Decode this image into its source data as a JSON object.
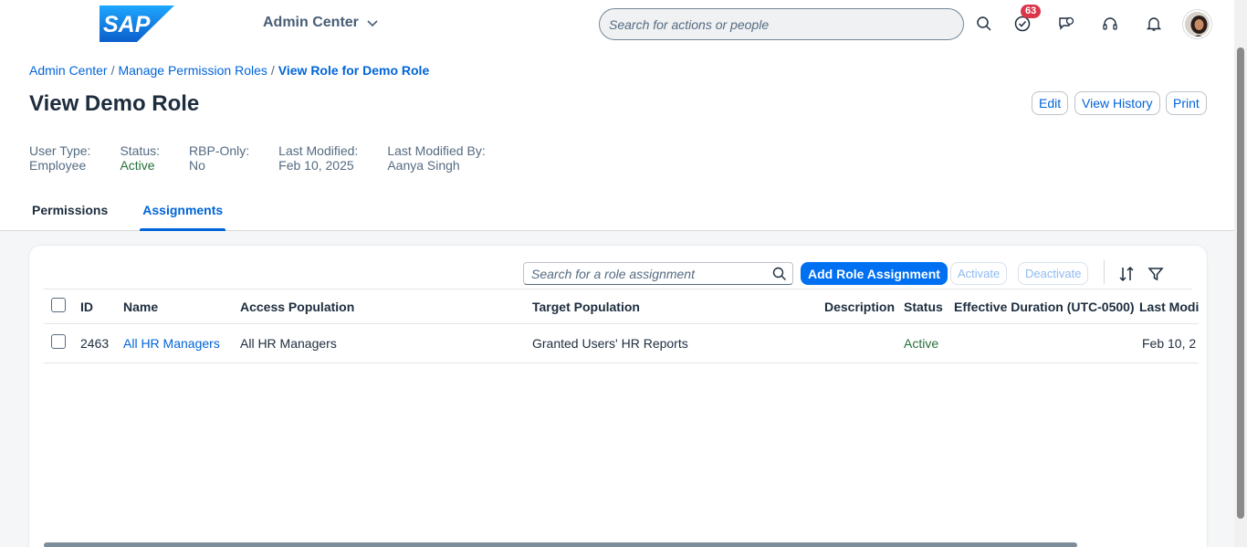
{
  "shell": {
    "logo_text": "SAP",
    "app_title": "Admin Center",
    "search_placeholder": "Search for actions or people",
    "notification_count": "63"
  },
  "breadcrumb": {
    "items": [
      "Admin Center",
      "Manage Permission Roles"
    ],
    "separator": "/",
    "current": "View Role for Demo Role"
  },
  "page": {
    "title": "View Demo Role",
    "actions": {
      "edit": "Edit",
      "history": "View History",
      "print": "Print"
    }
  },
  "attributes": [
    {
      "label": "User Type:",
      "value": "Employee"
    },
    {
      "label": "Status:",
      "value": "Active"
    },
    {
      "label": "RBP-Only:",
      "value": "No"
    },
    {
      "label": "Last Modified:",
      "value": "Feb 10, 2025"
    },
    {
      "label": "Last Modified By:",
      "value": "Aanya Singh"
    }
  ],
  "tabs": [
    "Permissions",
    "Assignments"
  ],
  "toolbar": {
    "search_placeholder": "Search for a role assignment",
    "add": "Add Role Assignment",
    "activate": "Activate",
    "deactivate": "Deactivate"
  },
  "table": {
    "columns": [
      "ID",
      "Name",
      "Access Population",
      "Target Population",
      "Description",
      "Status",
      "Effective Duration (UTC-0500)",
      "Last Modi"
    ],
    "rows": [
      {
        "id": "2463",
        "name": "All HR Managers",
        "access": "All HR Managers",
        "target": "Granted Users' HR Reports",
        "description": "",
        "status": "Active",
        "duration": "",
        "modified": "Feb 10, 2"
      }
    ]
  },
  "colors": {
    "accent": "#0070f2",
    "link": "#0064d9",
    "positive": "#256f3a",
    "badge": "#d9364c"
  }
}
